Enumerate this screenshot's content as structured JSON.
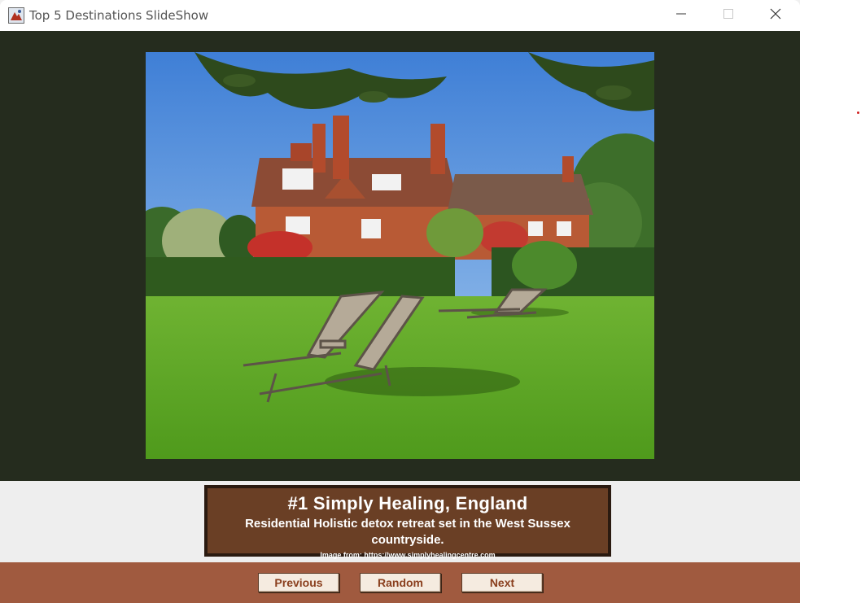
{
  "window": {
    "title": "Top 5 Destinations SlideShow",
    "icon": "java-app-icon",
    "controls": [
      "minimize-icon",
      "maximize-icon",
      "close-icon"
    ]
  },
  "slide": {
    "image_alt": "Manor house with lawn and sun loungers",
    "title": "#1 Simply Healing, England",
    "description": "Residential Holistic detox retreat set in the West Sussex countryside.",
    "source": "Image from: https://www.simplyhealingcentre.com"
  },
  "buttons": {
    "previous": "Previous",
    "random": "Random",
    "next": "Next"
  },
  "colors": {
    "image_panel_bg": "#252c1e",
    "caption_bg": "#6a3f25",
    "button_bar_bg": "#a05a3f",
    "button_text": "#8a3f1e"
  }
}
